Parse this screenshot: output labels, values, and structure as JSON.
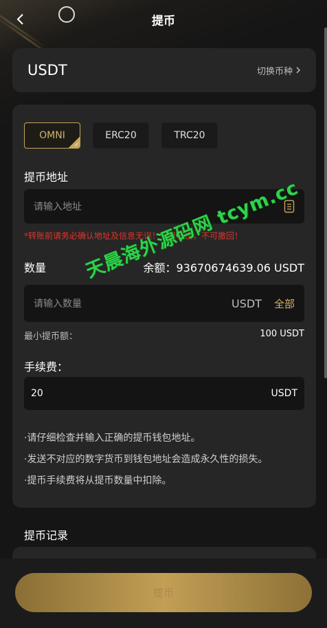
{
  "header": {
    "title": "提币"
  },
  "coin": {
    "name": "USDT",
    "switch_label": "切换币种"
  },
  "chains": [
    {
      "label": "OMNI",
      "active": true
    },
    {
      "label": "ERC20",
      "active": false
    },
    {
      "label": "TRC20",
      "active": false
    }
  ],
  "address": {
    "label": "提币地址",
    "placeholder": "请输入地址",
    "warning": "*转账前请务必确认地址及信息无误！一旦转出，不可撤回！"
  },
  "quantity": {
    "label": "数量",
    "balance_text": "余额：93670674639.06 USDT",
    "placeholder": "请输入数量",
    "unit": "USDT",
    "all_label": "全部",
    "min_label": "最小提币额：",
    "min_value": "100 USDT"
  },
  "fee": {
    "label": "手续费：",
    "value": "20",
    "unit": "USDT"
  },
  "notes": [
    "·请仔细检查并输入正确的提币钱包地址。",
    "·发送不对应的数字货币到钱包地址会造成永久性的损失。",
    "·提币手续费将从提币数量中扣除。"
  ],
  "records": {
    "title": "提币记录"
  },
  "submit": {
    "label": "提币"
  },
  "watermark": {
    "text": "天晨海外源码网 tcym.cc"
  },
  "colors": {
    "accent": "#c7a65d",
    "warning": "#e0342a",
    "card": "#262626",
    "background": "#151515"
  }
}
